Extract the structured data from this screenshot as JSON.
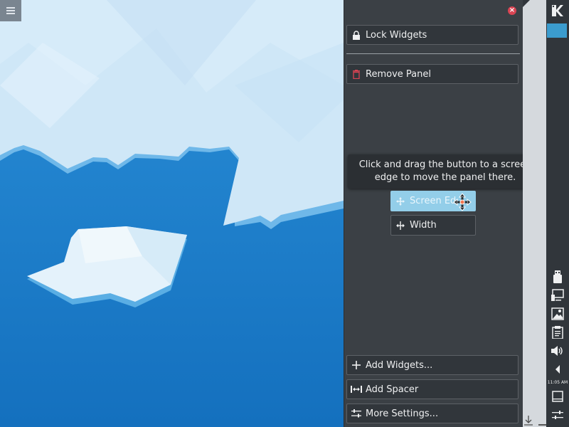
{
  "desktop": {
    "menu_icon": "hamburger-menu-icon"
  },
  "toolbox": {
    "close_icon": "close-icon",
    "lock_widgets": "Lock Widgets",
    "remove_panel": "Remove Panel",
    "add_widgets": "Add Widgets...",
    "add_spacer": "Add Spacer",
    "more_settings": "More Settings..."
  },
  "tooltip": {
    "text": "Click and drag the button to a screen edge to move the panel there."
  },
  "buttons": {
    "screen_edge": "Screen Ed",
    "width": "Width"
  },
  "panel": {
    "clock": "11:05 AM",
    "icons": [
      "kde-launcher-icon",
      "usb-device-icon",
      "display-icon",
      "clipboard-image-icon",
      "clipboard-icon",
      "volume-icon",
      "expand-arrow-icon",
      "show-desktop-icon",
      "panel-settings-icon"
    ]
  },
  "colors": {
    "accent": "#3daee9",
    "close": "#da4453",
    "toolbox_bg": "#3b4045",
    "panel_bg": "#31363b"
  }
}
